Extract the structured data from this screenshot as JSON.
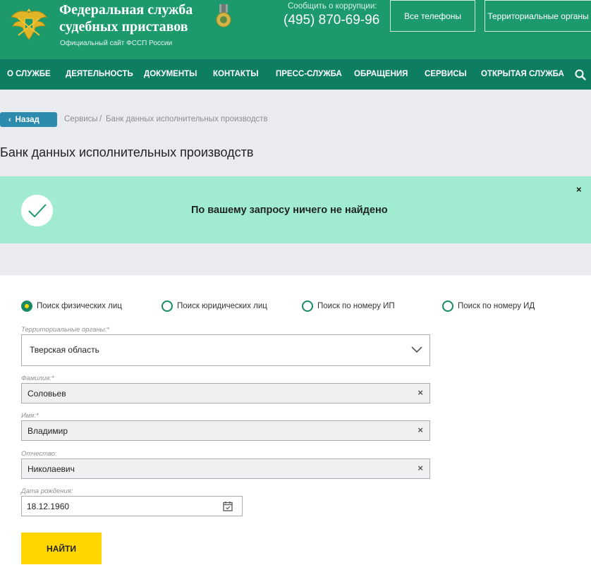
{
  "header": {
    "org_line1": "Федеральная служба",
    "org_line2": "судебных приставов",
    "subtitle": "Официальный сайт ФССП России",
    "corruption_label": "Сообщить о коррупции:",
    "corruption_phone": "(495) 870-69-96",
    "phones_button": "Все телефоны",
    "orgs_button": "Территориальные органы",
    "brand_color": "#1d9a6c"
  },
  "nav": {
    "items": [
      "О СЛУЖБЕ",
      "ДЕЯТЕЛЬНОСТЬ",
      "ДОКУМЕНТЫ",
      "КОНТАКТЫ",
      "ПРЕСС-СЛУЖБА",
      "ОБРАЩЕНИЯ",
      "СЕРВИСЫ",
      "ОТКРЫТАЯ СЛУЖБА"
    ],
    "search_icon": "search-icon",
    "color": "#0e7e63"
  },
  "breadcrumb": {
    "back_label": "Назад",
    "items": [
      "Сервисы",
      "Банк данных исполнительных производств"
    ],
    "separator": "/"
  },
  "page_title": "Банк данных исполнительных производств",
  "alert": {
    "message": "По вашему запросу ничего не найдено",
    "icon": "checkmark-icon",
    "close": "×",
    "color": "#a1ecd0"
  },
  "search_types": [
    {
      "label": "Поиск физических лиц",
      "checked": true
    },
    {
      "label": "Поиск юридических лиц",
      "checked": false
    },
    {
      "label": "Поиск по номеру ИП",
      "checked": false
    },
    {
      "label": "Поиск по номеру ИД",
      "checked": false
    }
  ],
  "form": {
    "region_label": "Территориальные органы:*",
    "region_value": "Тверская область",
    "lastname_label": "Фамилия:*",
    "lastname_value": "Соловьев",
    "firstname_label": "Имя:*",
    "firstname_value": "Владимир",
    "patronymic_label": "Отчество:",
    "patronymic_value": "Николаевич",
    "birthdate_label": "Дата рождения:",
    "birthdate_value": "18.12.1960",
    "clear_glyph": "×",
    "submit_label": "НАЙТИ",
    "submit_color": "#ffd600"
  }
}
